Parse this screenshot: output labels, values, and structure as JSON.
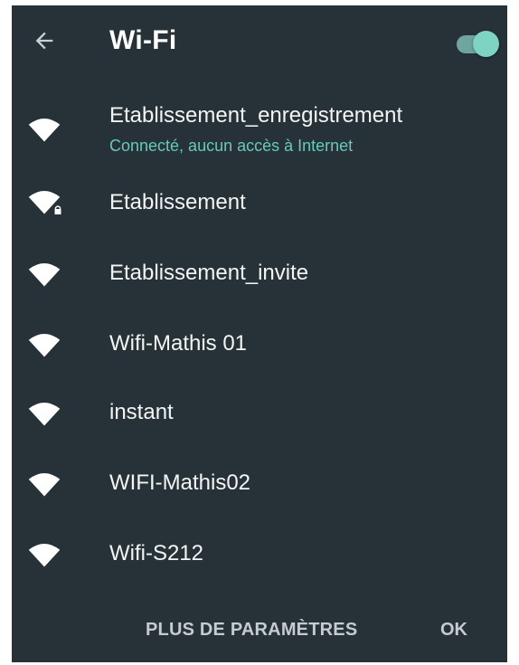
{
  "header": {
    "back_icon": "arrow-left-icon",
    "title": "Wi-Fi",
    "wifi_enabled": true
  },
  "networks": [
    {
      "name": "Etablissement_enregistrement",
      "status": "Connecté, aucun accès à Internet",
      "secured": false,
      "icon": "wifi-icon"
    },
    {
      "name": "Etablissement",
      "secured": true,
      "icon": "wifi-lock-icon"
    },
    {
      "name": "Etablissement_invite",
      "secured": false,
      "icon": "wifi-icon"
    },
    {
      "name": "Wifi-Mathis 01",
      "secured": false,
      "icon": "wifi-icon"
    },
    {
      "name": "instant",
      "secured": false,
      "icon": "wifi-icon"
    },
    {
      "name": "WIFI-Mathis02",
      "secured": false,
      "icon": "wifi-icon"
    },
    {
      "name": "Wifi-S212",
      "secured": false,
      "icon": "wifi-icon"
    }
  ],
  "footer": {
    "more_settings_label": "PLUS DE PARAMÈTRES",
    "ok_label": "OK"
  },
  "colors": {
    "dialog_background": "#263238",
    "accent": "#7fd3c3",
    "status_text": "#66c9b9",
    "button_text": "#c5cbcf"
  }
}
